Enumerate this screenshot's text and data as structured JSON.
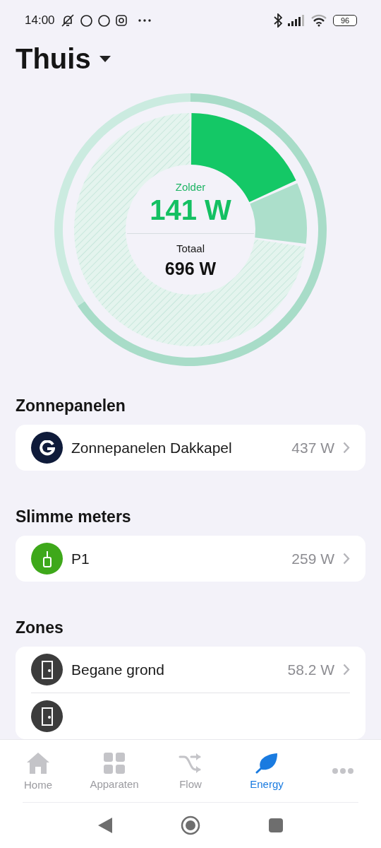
{
  "status_bar": {
    "time": "14:00",
    "battery": "96"
  },
  "header": {
    "title": "Thuis"
  },
  "summary": {
    "zone_label": "Zolder",
    "zone_value": "141 W",
    "total_label": "Totaal",
    "total_value": "696 W"
  },
  "sections": [
    {
      "title": "Zonnepanelen",
      "items": [
        {
          "kind": "solar",
          "name": "Zonnepanelen Dakkapel",
          "value": "437 W"
        }
      ]
    },
    {
      "title": "Slimme meters",
      "items": [
        {
          "kind": "meter",
          "name": "P1",
          "value": "259 W"
        }
      ]
    },
    {
      "title": "Zones",
      "items": [
        {
          "kind": "zone",
          "name": "Begane grond",
          "value": "58.2 W"
        },
        {
          "kind": "zone"
        }
      ]
    }
  ],
  "nav": [
    {
      "kind": "home",
      "label": "Home",
      "selected": false
    },
    {
      "kind": "devices",
      "label": "Apparaten",
      "selected": false
    },
    {
      "kind": "flow",
      "label": "Flow",
      "selected": false
    },
    {
      "kind": "energy",
      "label": "Energy",
      "selected": true
    },
    {
      "kind": "more",
      "selected": false
    }
  ]
}
